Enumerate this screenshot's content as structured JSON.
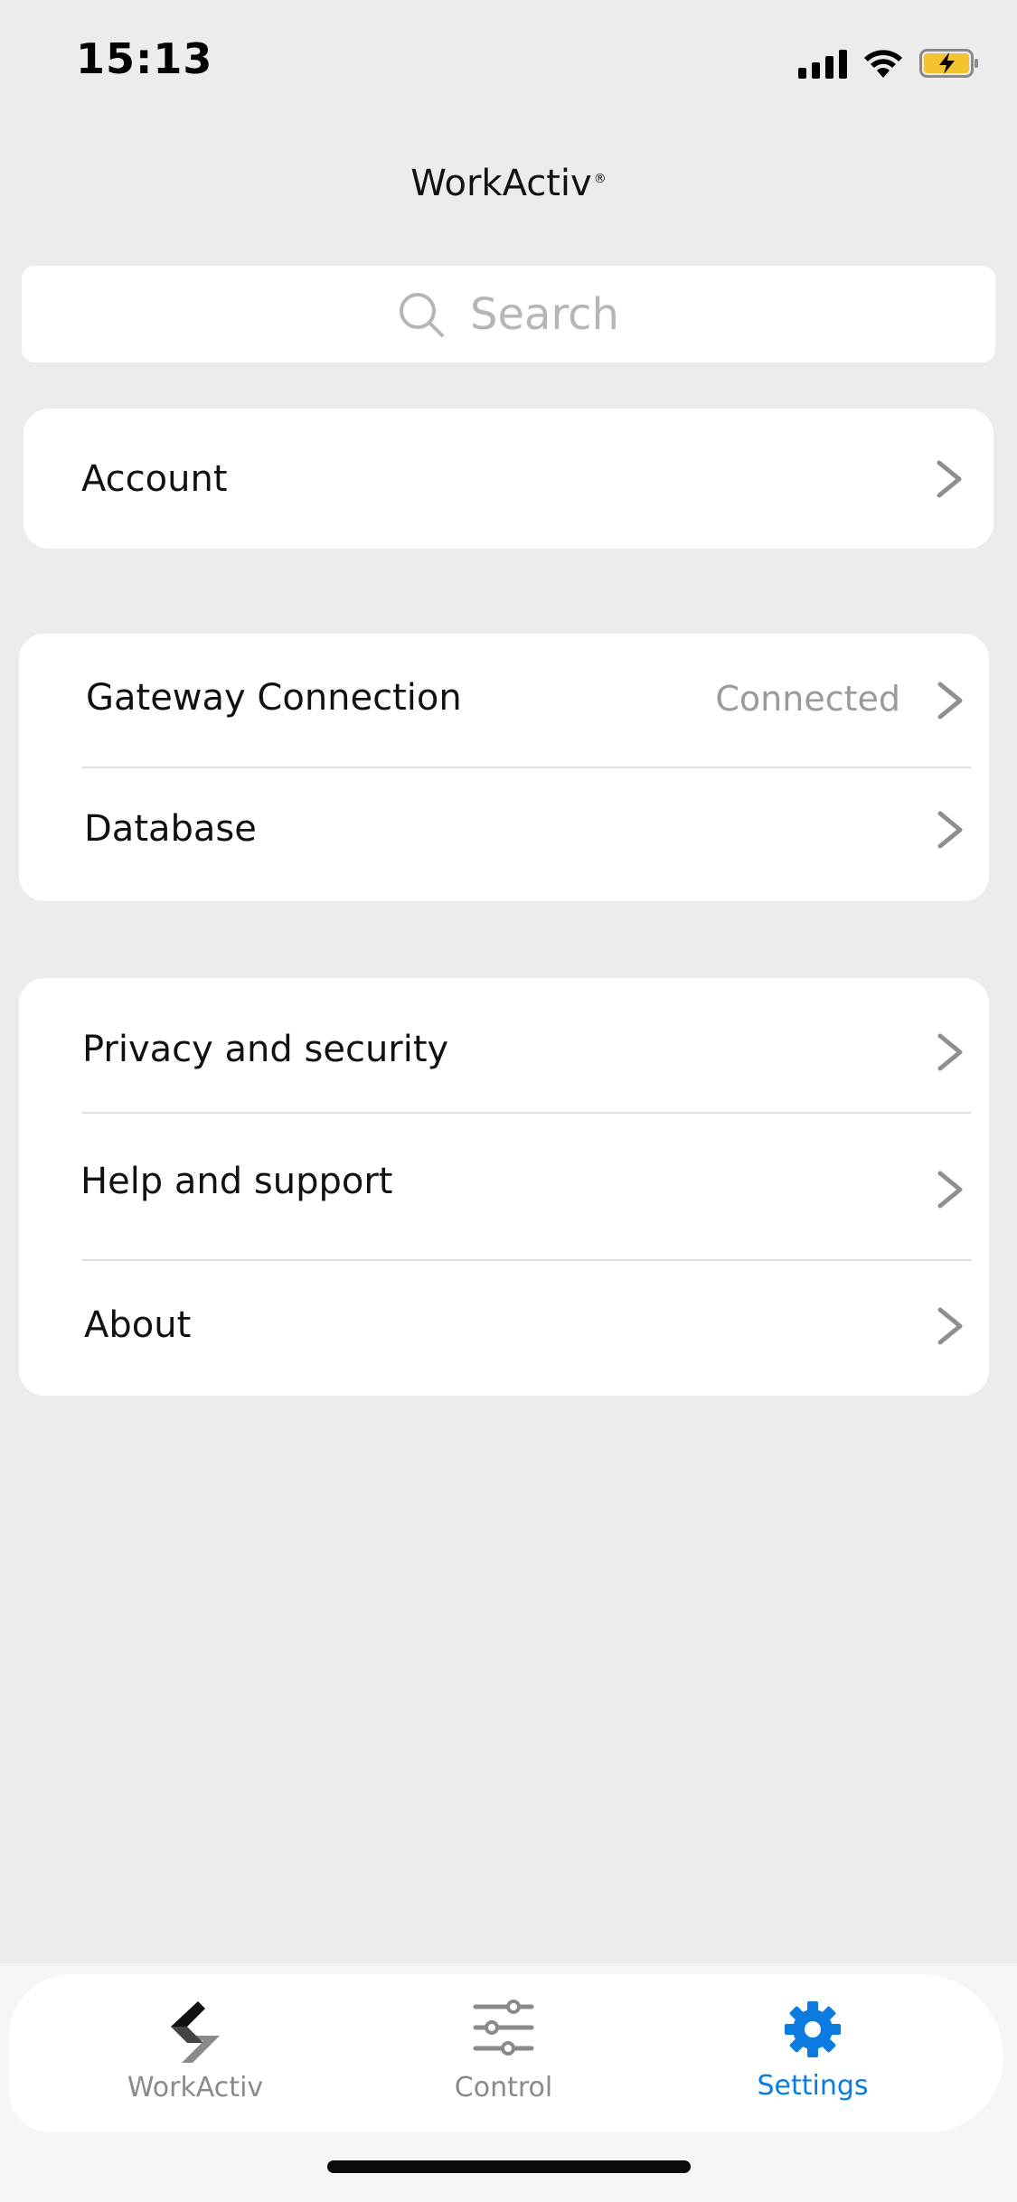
{
  "status_bar": {
    "time": "15:13"
  },
  "header": {
    "title": "WorkActiv",
    "registered_mark": "®"
  },
  "search": {
    "placeholder": "Search"
  },
  "groups": {
    "account": {
      "label": "Account"
    },
    "connection": {
      "gateway_label": "Gateway Connection",
      "gateway_value": "Connected",
      "database_label": "Database"
    },
    "info": {
      "privacy_label": "Privacy and security",
      "help_label": "Help and support",
      "about_label": "About"
    }
  },
  "tabbar": {
    "tabs": [
      {
        "label": "WorkActiv",
        "icon": "workactiv-logo-icon",
        "active": false
      },
      {
        "label": "Control",
        "icon": "sliders-icon",
        "active": false
      },
      {
        "label": "Settings",
        "icon": "gear-icon",
        "active": true
      }
    ]
  },
  "colors": {
    "background": "#ececec",
    "card": "#ffffff",
    "accent": "#0b7be0",
    "inactive_tab": "#8a8a8a",
    "secondary_text": "#9a9a9a",
    "battery_fill": "#f4c430"
  }
}
